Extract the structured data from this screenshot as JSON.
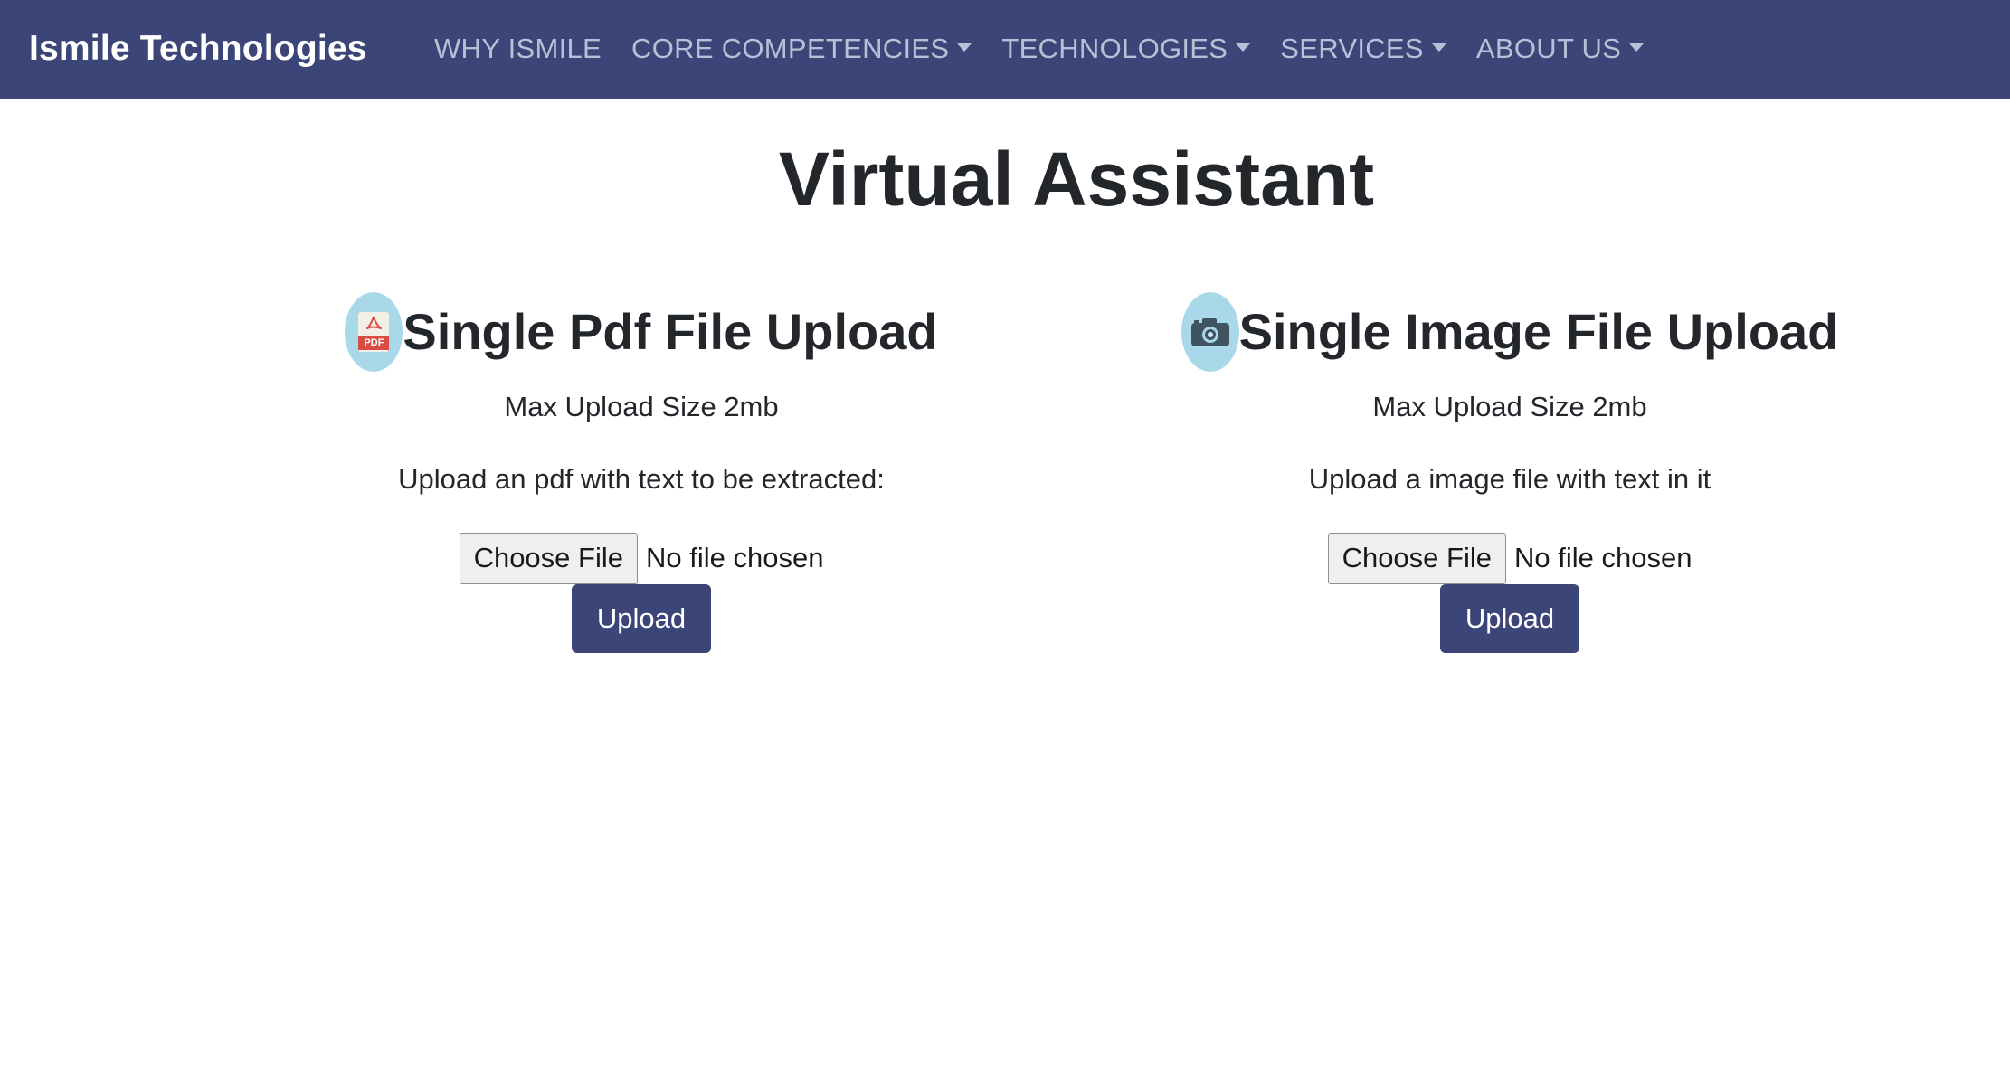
{
  "navbar": {
    "brand": "Ismile Technologies",
    "items": [
      {
        "label": "WHY ISMILE",
        "dropdown": false
      },
      {
        "label": "CORE COMPETENCIES",
        "dropdown": true
      },
      {
        "label": "TECHNOLOGIES",
        "dropdown": true
      },
      {
        "label": "SERVICES",
        "dropdown": true
      },
      {
        "label": "ABOUT US",
        "dropdown": true
      }
    ]
  },
  "page": {
    "title": "Virtual Assistant"
  },
  "pdf_upload": {
    "icon": "pdf-file-icon",
    "icon_badge": "PDF",
    "heading": "Single Pdf File Upload",
    "max_size": "Max Upload Size 2mb",
    "instruction": "Upload an pdf with text to be extracted:",
    "choose_label": "Choose File",
    "file_status": "No file chosen",
    "upload_label": "Upload"
  },
  "image_upload": {
    "icon": "camera-icon",
    "heading": "Single Image File Upload",
    "max_size": "Max Upload Size 2mb",
    "instruction": "Upload a image file with text in it",
    "choose_label": "Choose File",
    "file_status": "No file chosen",
    "upload_label": "Upload"
  },
  "colors": {
    "navbar_bg": "#3b4577",
    "nav_text": "#b9bfd6",
    "icon_circle": "#a9d8e8",
    "button_bg": "#3b4577"
  }
}
